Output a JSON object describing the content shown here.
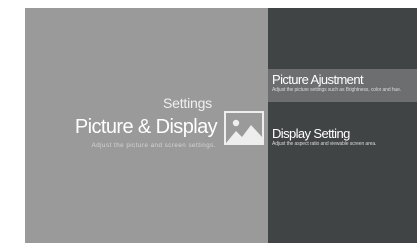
{
  "header": {
    "breadcrumb": "Settings",
    "title": "Picture & Display",
    "description": "Adjust the picture and screen settings."
  },
  "icons": {
    "header_icon": "picture-icon"
  },
  "menu": {
    "items": [
      {
        "title": "Picture Ajustment",
        "subtitle": "Adjust the picture settings such as Brightness, color and hue.",
        "selected": true
      },
      {
        "title": "Display Setting",
        "subtitle": "Adjust the aspect ratio and viewable screen area.",
        "selected": false
      }
    ]
  },
  "colors": {
    "left_panel": "#9a9a9a",
    "right_panel": "#414445",
    "selected_highlight": "#6c6e70"
  }
}
